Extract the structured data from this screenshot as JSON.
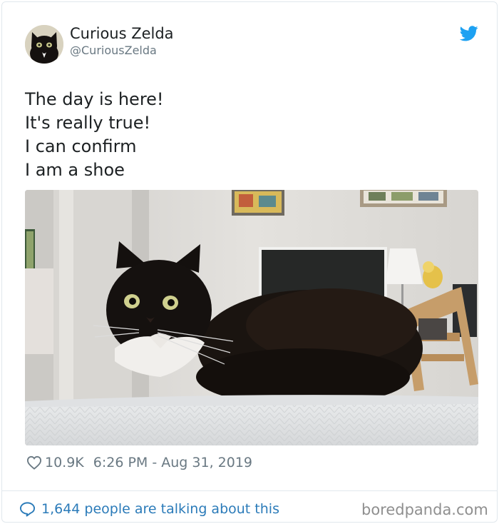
{
  "author": {
    "display_name": "Curious Zelda",
    "handle": "@CuriousZelda",
    "avatar_icon": "cat-avatar"
  },
  "tweet": {
    "lines": [
      "The day is here!",
      "It's really true!",
      "I can confirm",
      "I am a shoe"
    ],
    "photo_subject": "black and white cat loafing on a bed"
  },
  "meta": {
    "likes": "10.9K",
    "timestamp": "6:26 PM - Aug 31, 2019"
  },
  "footer": {
    "talking_text": "1,644 people are talking about this"
  },
  "watermark": "boredpanda.com",
  "colors": {
    "twitter_blue": "#1da1f2",
    "link_blue": "#2b7bb9",
    "text": "#1c2022",
    "muted": "#697882"
  }
}
